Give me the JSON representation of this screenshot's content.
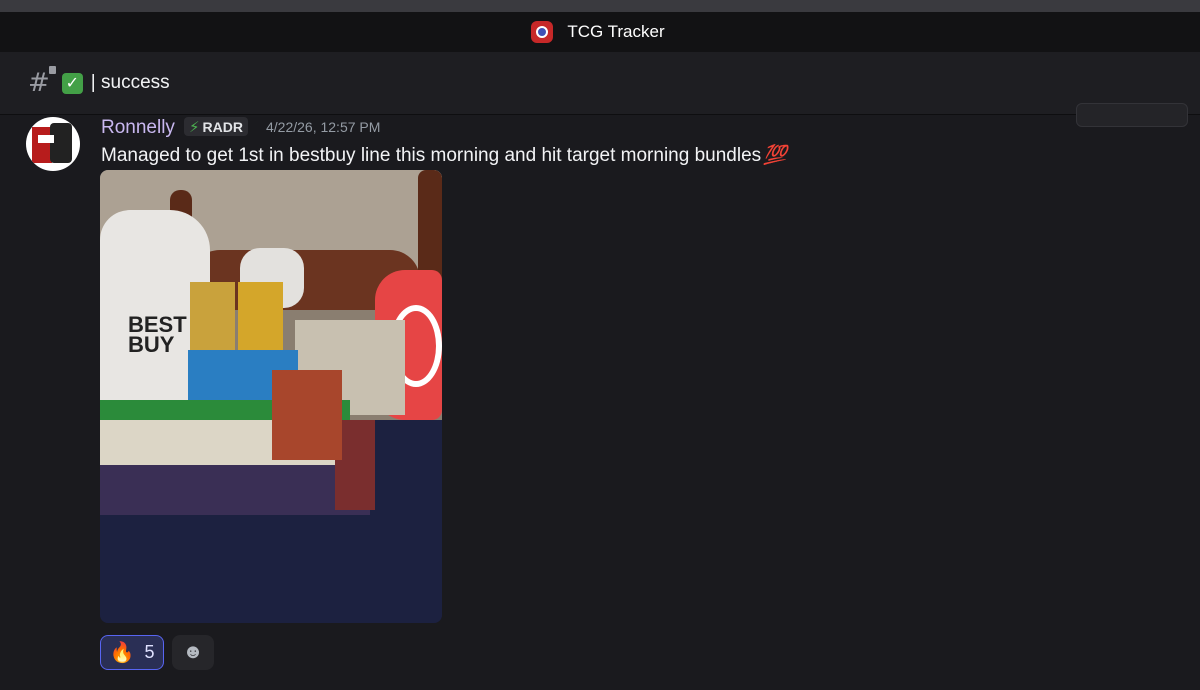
{
  "window": {
    "title": "TCG Tracker"
  },
  "channel": {
    "name": "success",
    "status_emoji": "✓",
    "separator": "|"
  },
  "message": {
    "author": "Ronnelly",
    "tag": "RADR",
    "timestamp": "4/22/26, 12:57 PM",
    "text": "Managed to get 1st in bestbuy line this morning and hit target morning bundles",
    "text_emoji": "💯",
    "image_text": {
      "bag": "BEST BUY"
    },
    "reactions": [
      {
        "emoji": "🔥",
        "count": "5"
      }
    ],
    "add_reaction_icon": "☻"
  },
  "colors": {
    "accent": "#5865f2",
    "username": "#c9b8f0",
    "bolt": "#4caf50"
  }
}
